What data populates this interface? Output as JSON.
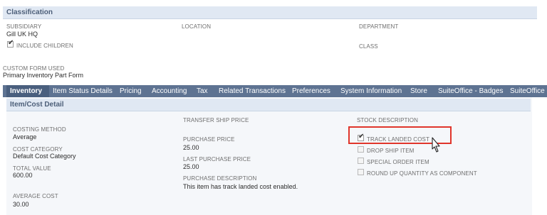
{
  "classification": {
    "title": "Classification",
    "subsidiary_label": "SUBSIDIARY",
    "subsidiary_value": "Gill UK HQ",
    "include_children_label": "INCLUDE CHILDREN",
    "include_children_checked": true,
    "location_label": "LOCATION",
    "department_label": "DEPARTMENT",
    "class_label": "CLASS"
  },
  "custom_form": {
    "label": "CUSTOM FORM USED",
    "value": "Primary Inventory Part Form"
  },
  "tabs": [
    {
      "label": "Inventory",
      "active": true
    },
    {
      "label": "Item Status Details"
    },
    {
      "label": "Pricing"
    },
    {
      "label": "Accounting"
    },
    {
      "label": "Tax"
    },
    {
      "label": "Related Transactions"
    },
    {
      "label": "Preferences"
    },
    {
      "label": "System Information"
    },
    {
      "label": "Store"
    },
    {
      "label": "SuiteOffice - Badges"
    },
    {
      "label": "SuiteOffice -"
    }
  ],
  "item_cost": {
    "title": "Item/Cost Detail",
    "costing_method_label": "COSTING METHOD",
    "costing_method_value": "Average",
    "cost_category_label": "COST CATEGORY",
    "cost_category_value": "Default Cost Category",
    "total_value_label": "TOTAL VALUE",
    "total_value_value": "600.00",
    "average_cost_label": "AVERAGE COST",
    "average_cost_value": "30.00",
    "transfer_ship_price_label": "TRANSFER SHIP PRICE",
    "purchase_price_label": "PURCHASE PRICE",
    "purchase_price_value": "25.00",
    "last_purchase_price_label": "LAST PURCHASE PRICE",
    "last_purchase_price_value": "25.00",
    "purchase_description_label": "PURCHASE DESCRIPTION",
    "purchase_description_value": "This item has track landed cost enabled.",
    "stock_description_label": "STOCK DESCRIPTION",
    "track_landed_cost_label": "TRACK LANDED COST",
    "track_landed_cost_checked": true,
    "drop_ship_item_label": "DROP SHIP ITEM",
    "special_order_item_label": "SPECIAL ORDER ITEM",
    "round_up_label": "ROUND UP QUANTITY AS COMPONENT"
  },
  "colors": {
    "tab_bar": "#5e7392",
    "section_header": "#e0e8f3",
    "highlight": "#e0352b"
  },
  "icons": [
    "checkmark-icon",
    "mouse-cursor-icon"
  ]
}
